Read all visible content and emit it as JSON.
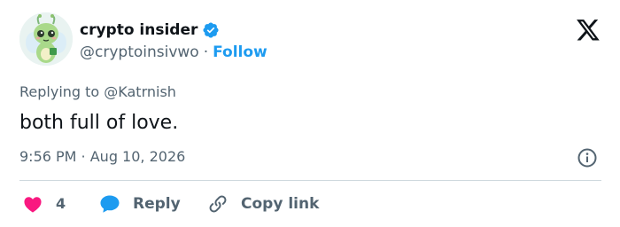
{
  "author": {
    "display_name": "crypto insider",
    "handle": "@cryptoinsivwo",
    "separator": "·",
    "follow_label": "Follow",
    "verified": true
  },
  "tweet": {
    "replying_to": "Replying to @Katrnish",
    "text": "both full of love.",
    "timestamp": "9:56 PM · Aug 10, 2026"
  },
  "actions": {
    "like_count": "4",
    "reply_label": "Reply",
    "copy_link_label": "Copy link"
  },
  "icons": {
    "brand": "x-logo-icon",
    "verified": "verified-badge-icon",
    "info": "info-icon",
    "like": "heart-icon",
    "reply": "reply-bubble-icon",
    "copy": "link-icon"
  },
  "colors": {
    "accent": "#1d9bf0",
    "like": "#f91880",
    "text_secondary": "#536471",
    "text_primary": "#0f1419"
  }
}
